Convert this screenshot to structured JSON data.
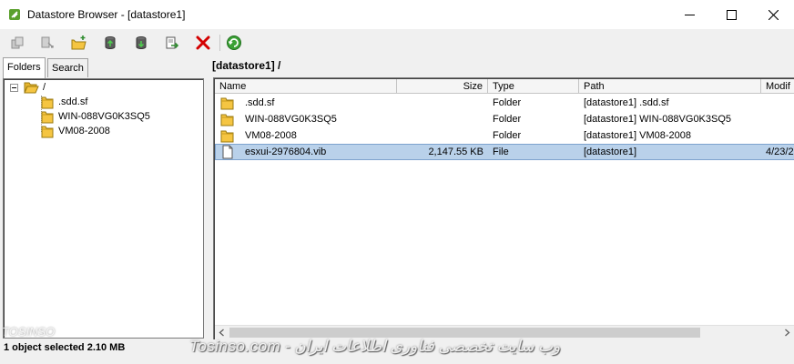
{
  "window": {
    "title": "Datastore Browser - [datastore1]"
  },
  "toolbar": {
    "buttons": [
      {
        "icon": "upload-icon",
        "enabled": false
      },
      {
        "icon": "download-icon",
        "enabled": false
      },
      {
        "icon": "new-folder-icon",
        "enabled": true
      },
      {
        "icon": "datastore-upload-icon",
        "enabled": true
      },
      {
        "icon": "datastore-download-icon",
        "enabled": true
      },
      {
        "icon": "move-icon",
        "enabled": true
      },
      {
        "icon": "delete-icon",
        "enabled": true
      },
      {
        "icon": "refresh-icon",
        "enabled": true
      }
    ]
  },
  "left": {
    "tabs": [
      {
        "label": "Folders",
        "active": true
      },
      {
        "label": "Search",
        "active": false
      }
    ],
    "tree": {
      "root": "/",
      "children": [
        ".sdd.sf",
        "WIN-088VG0K3SQ5",
        "VM08-2008"
      ]
    }
  },
  "right": {
    "path": "[datastore1] /",
    "columns": [
      "Name",
      "Size",
      "Type",
      "Path",
      "Modif"
    ],
    "rows": [
      {
        "name": ".sdd.sf",
        "size": "",
        "type": "Folder",
        "path": "[datastore1] .sdd.sf",
        "modified": "",
        "icon": "folder-icon",
        "selected": false
      },
      {
        "name": "WIN-088VG0K3SQ5",
        "size": "",
        "type": "Folder",
        "path": "[datastore1] WIN-088VG0K3SQ5",
        "modified": "",
        "icon": "folder-icon",
        "selected": false
      },
      {
        "name": "VM08-2008",
        "size": "",
        "type": "Folder",
        "path": "[datastore1] VM08-2008",
        "modified": "",
        "icon": "folder-icon",
        "selected": false
      },
      {
        "name": "esxui-2976804.vib",
        "size": "2,147.55 KB",
        "type": "File",
        "path": "[datastore1]",
        "modified": "4/23/2",
        "icon": "file-icon",
        "selected": true
      }
    ]
  },
  "status": {
    "text": "1 object selected 2.10 MB"
  },
  "watermark": {
    "text": "وب سایت تخصصی فناوری اطلاعات ایران - Tosinso.com",
    "small": "TOSINSO"
  },
  "colors": {
    "selection": "#b9d1ea",
    "folder": "#f5c542",
    "delete": "#d40000",
    "refresh": "#3aa135"
  }
}
